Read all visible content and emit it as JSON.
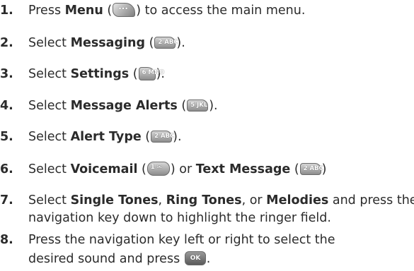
{
  "steps": [
    {
      "num": "1.",
      "parts": [
        "Press ",
        "Menu",
        " (",
        ") to access the main menu."
      ],
      "key": "···"
    },
    {
      "num": "2.",
      "parts": [
        "Select ",
        "Messaging",
        " (",
        ")."
      ],
      "key": "2 ABC"
    },
    {
      "num": "3.",
      "parts": [
        "Select ",
        "Settings",
        " (",
        ")."
      ],
      "key": "6 MNO"
    },
    {
      "num": "4.",
      "parts": [
        "Select ",
        "Message Alerts",
        " (",
        ")."
      ],
      "key": "5 JKL"
    },
    {
      "num": "5.",
      "parts": [
        "Select ",
        "Alert Type",
        " (",
        ")."
      ],
      "key": "2 ABC"
    },
    {
      "num": "6.",
      "parts": [
        "Select ",
        "Voicemail",
        " (",
        ") or ",
        "Text Message",
        " (",
        ")"
      ],
      "key": "1 ✉",
      "key2": "2 ABC"
    },
    {
      "num": "7.",
      "line1": [
        "Select ",
        "Single Tones",
        ", ",
        "Ring Tones",
        ", or ",
        "Melodies",
        " and press the"
      ],
      "line2": "navigation key down to highlight the ringer field."
    },
    {
      "num": "8.",
      "line1": "Press the navigation key left or right to select the",
      "line2": "desired sound and press ",
      "key": "OK"
    }
  ],
  "colors": {
    "text": "#2b2b2b",
    "key_light": "#d6d6d6",
    "key_dark": "#8d8d8d"
  }
}
